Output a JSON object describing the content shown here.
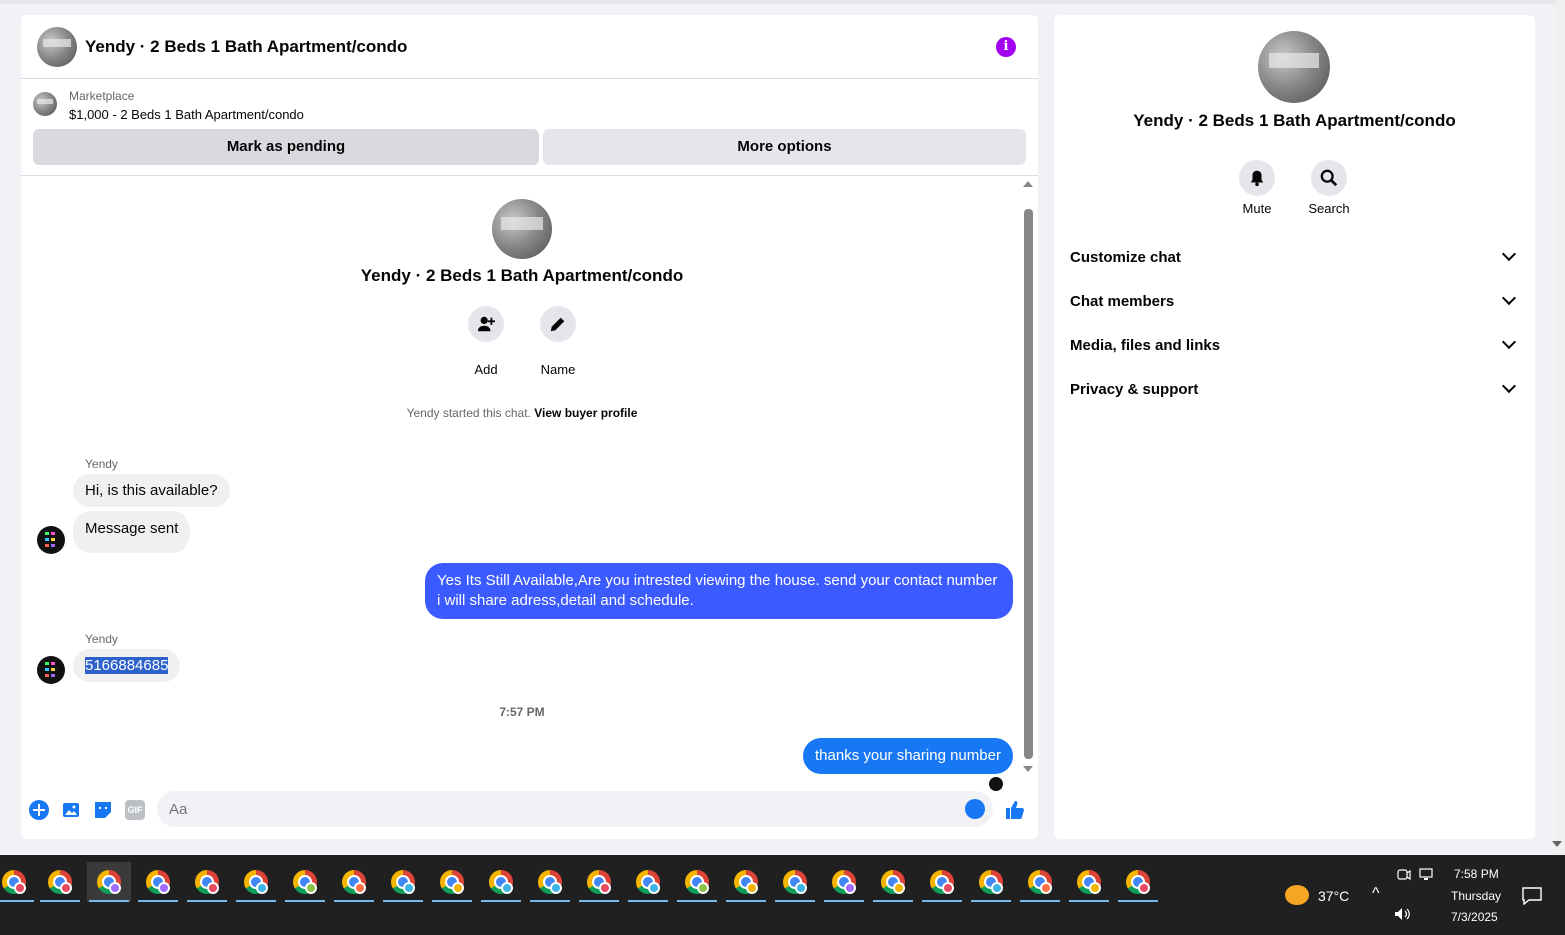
{
  "header": {
    "title": "Yendy · 2 Beds 1 Bath Apartment/condo"
  },
  "listing": {
    "category": "Marketplace",
    "name": "$1,000 - 2 Beds 1 Bath Apartment/condo",
    "mark_pending_label": "Mark as pending",
    "more_options_label": "More options"
  },
  "conversation": {
    "title": "Yendy · 2 Beds 1 Bath Apartment/condo",
    "add_label": "Add",
    "name_label": "Name",
    "started_text": "Yendy started this chat.",
    "view_profile_label": "View buyer profile",
    "messages": [
      {
        "sender": "Yendy",
        "text": "Hi, is this available?"
      },
      {
        "text": "Message sent"
      },
      {
        "text": "Yes Its Still Available,Are you intrested viewing the house. send your contact number i will share adress,detail and schedule."
      },
      {
        "sender": "Yendy",
        "text": "5166884685"
      },
      {
        "text": "thanks your sharing number"
      }
    ],
    "timestamp": "7:57 PM"
  },
  "composer": {
    "placeholder": "Aa",
    "gif_label": "GIF"
  },
  "sidebar": {
    "title": "Yendy · 2 Beds 1 Bath Apartment/condo",
    "mute_label": "Mute",
    "search_label": "Search",
    "sections": [
      {
        "label": "Customize chat"
      },
      {
        "label": "Chat members"
      },
      {
        "label": "Media, files and links"
      },
      {
        "label": "Privacy & support"
      }
    ]
  },
  "taskbar": {
    "temperature": "37°C",
    "time": "7:58 PM",
    "day": "Thursday",
    "date": "7/3/2025"
  },
  "colors": {
    "accent": "#1877f2",
    "outgoing_bubble": "#3b5aff",
    "info_icon": "#a100f2",
    "taskbar": "#202020"
  }
}
